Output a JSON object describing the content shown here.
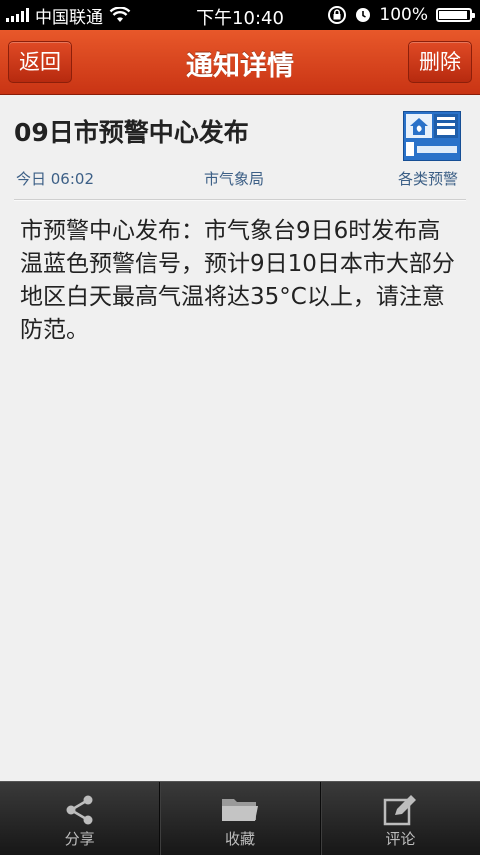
{
  "status_bar": {
    "carrier": "中国联通",
    "time": "下午10:40",
    "battery": "100%",
    "battery_level": 1.0
  },
  "nav": {
    "back_label": "返回",
    "title": "通知详情",
    "delete_label": "删除"
  },
  "notice": {
    "title": "09日市预警中心发布",
    "date": "今日 06:02",
    "source": "市气象局",
    "category": "各类预警",
    "badge_icon": "heat-wave-blue-warning-icon",
    "body": "市预警中心发布：市气象台9日6时发布高温蓝色预警信号，预计9日10日本市大部分地区白天最高气温将达35°C以上，请注意防范。"
  },
  "tabs": [
    {
      "label": "分享",
      "icon": "share-icon"
    },
    {
      "label": "收藏",
      "icon": "folder-icon"
    },
    {
      "label": "评论",
      "icon": "edit-icon"
    }
  ],
  "colors": {
    "nav_red": "#d9441d",
    "meta_blue": "#3c5f86",
    "badge_blue": "#2a72c9"
  }
}
